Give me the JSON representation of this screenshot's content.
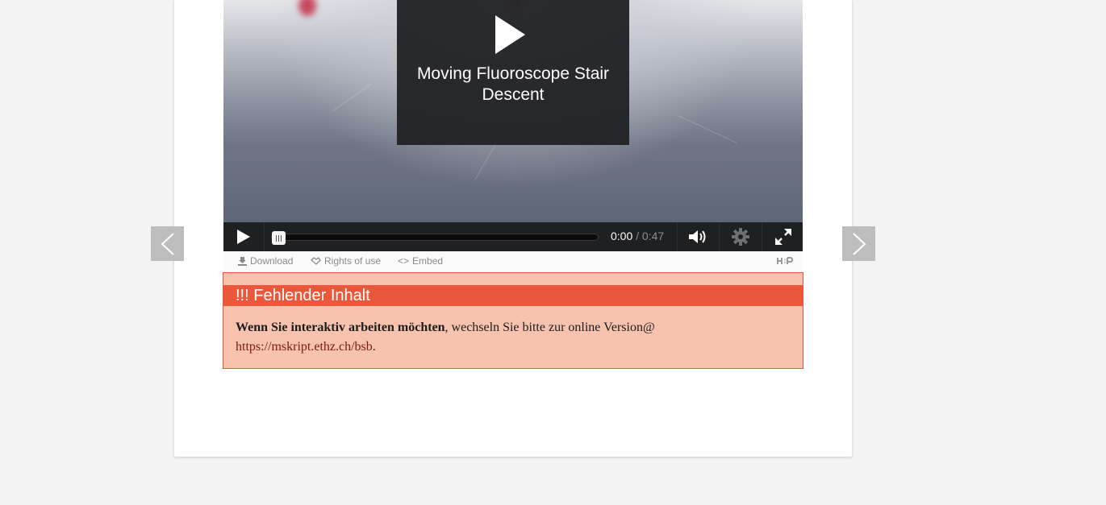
{
  "navigation": {
    "prev_label": "Previous slide",
    "next_label": "Next slide",
    "prev_icon": "chevron-left-icon",
    "next_icon": "chevron-right-icon"
  },
  "video": {
    "title": "Moving Fluoroscope Stair Descent",
    "current_time": "0:00",
    "separator": "/",
    "duration": "0:47",
    "progress": 0
  },
  "actions": {
    "download": "Download",
    "rights": "Rights of use",
    "embed": "Embed",
    "h5p": "H5P"
  },
  "missing_content": {
    "heading": "!!! Fehlender Inhalt",
    "bold_text": "Wenn Sie interaktiv arbeiten möchten",
    "text": ", wechseln Sie bitte zur online Version@ ",
    "link": "https://mskript.ethz.ch/bsb",
    "suffix": "."
  },
  "colors": {
    "alert_header": "#ea573a",
    "alert_background": "#f7c2ae",
    "player_bar": "#1f2022",
    "nav_button": "#bdbdbd"
  }
}
